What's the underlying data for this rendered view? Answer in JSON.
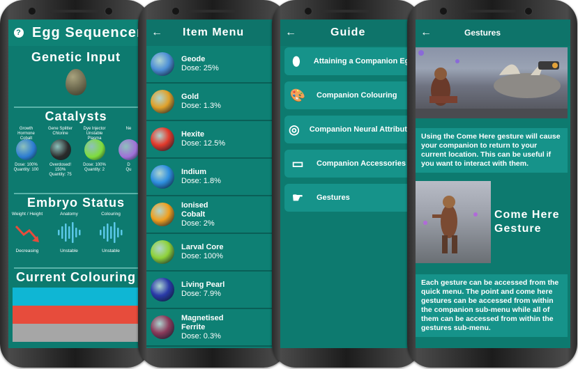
{
  "sequencer": {
    "title": "Egg Sequencer",
    "help_icon": "?",
    "genetic_input": "Genetic Input",
    "catalysts_title": "Catalysts",
    "catalysts": [
      {
        "name": "Growth Hormone\nCobalt",
        "dose": "Dose: 100%",
        "qty": "Quantity: 100",
        "color": "#2b7bd1"
      },
      {
        "name": "Gene Splitter\nChlorine",
        "dose": "Overdosed! 150%",
        "qty": "Quantity: 75",
        "color": "#2a2a2a"
      },
      {
        "name": "Dye Injector\nUnstable Plasma",
        "dose": "Dose: 100%",
        "qty": "Quantity: 2",
        "color": "#7fdc3c"
      },
      {
        "name": "Ne",
        "dose": "D",
        "qty": "Qu",
        "color": "#a06fd8"
      }
    ],
    "embryo_title": "Embryo Status",
    "embryo": [
      {
        "label": "Weight / Height",
        "status": "Decreasing"
      },
      {
        "label": "Anatomy",
        "status": "Unstable"
      },
      {
        "label": "Colouring",
        "status": "Unstable"
      }
    ],
    "colouring_title": "Current Colouring",
    "colours": [
      "#0fb6d4",
      "#e74c3c",
      "#a6a6a6"
    ]
  },
  "item_menu": {
    "title": "Item Menu",
    "items": [
      {
        "name": "Geode",
        "dose": "Dose: 25%",
        "color": "#4d8fd6"
      },
      {
        "name": "Gold",
        "dose": "Dose: 1.3%",
        "color": "#e0a12a"
      },
      {
        "name": "Hexite",
        "dose": "Dose: 12.5%",
        "color": "#e33a2b"
      },
      {
        "name": "Indium",
        "dose": "Dose: 1.8%",
        "color": "#2e8fe0"
      },
      {
        "name": "Ionised\nCobalt",
        "dose": "Dose: 2%",
        "color": "#f0a020"
      },
      {
        "name": "Larval Core",
        "dose": "Dose: 100%",
        "color": "#8fd23a"
      },
      {
        "name": "Living Pearl",
        "dose": "Dose: 7.9%",
        "color": "#2a3aa8"
      },
      {
        "name": "Magnetised\nFerrite",
        "dose": "Dose: 0.3%",
        "color": "#8a3a5a"
      }
    ]
  },
  "guide": {
    "title": "Guide",
    "items": [
      {
        "label": "Attaining a Companion Egg",
        "icon": "egg-icon"
      },
      {
        "label": "Companion Colouring",
        "icon": "palette-icon"
      },
      {
        "label": "Companion Neural Attributes",
        "icon": "brain-icon"
      },
      {
        "label": "Companion Accessories",
        "icon": "inbox-icon"
      },
      {
        "label": "Gestures",
        "icon": "pointing-hand-icon"
      }
    ]
  },
  "gestures": {
    "title": "Gestures",
    "para1": "Using the Come Here gesture will cause your companion to return to your current location. This can be useful if you want to interact with them.",
    "come_here": "Come Here Gesture",
    "para2": "Each gesture can be accessed from the quick menu. The point and come here gestures can be accessed from within the companion sub-menu while all of them can be accessed from within the gestures sub-menu."
  }
}
